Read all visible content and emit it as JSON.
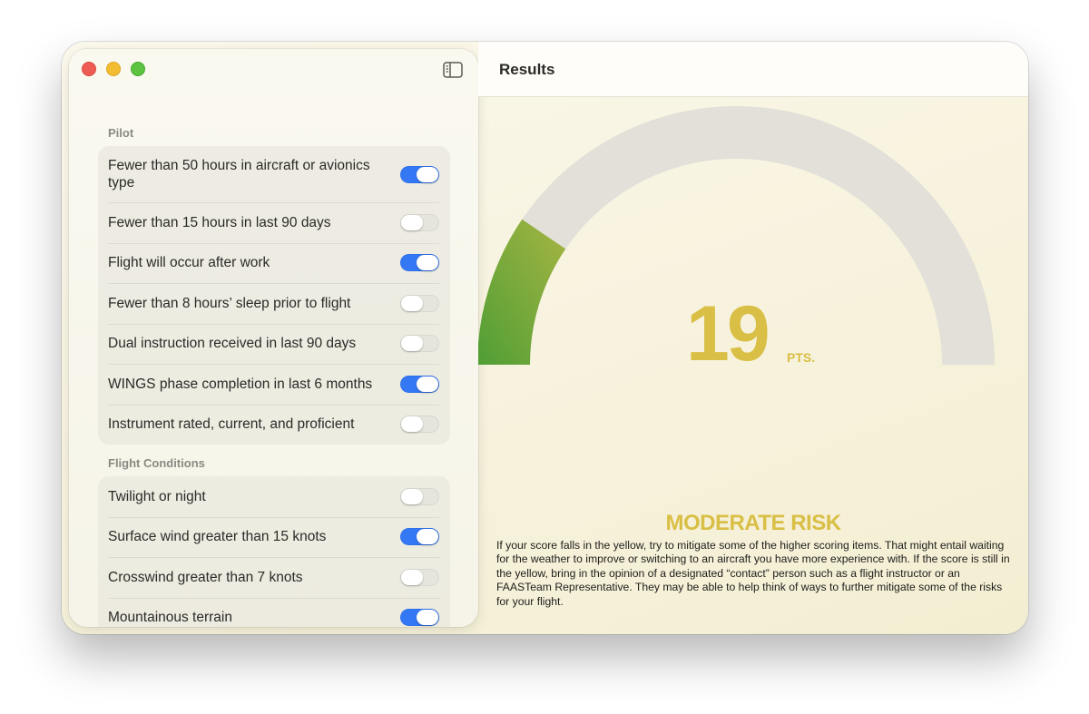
{
  "window": {
    "title": "Results"
  },
  "sidebar": {
    "sections": [
      {
        "label": "Pilot",
        "items": [
          {
            "label": "Fewer than 50 hours in aircraft or avionics type",
            "on": true
          },
          {
            "label": "Fewer than 15 hours in last 90 days",
            "on": false
          },
          {
            "label": "Flight will occur after work",
            "on": true
          },
          {
            "label": "Fewer than 8 hours’ sleep prior to flight",
            "on": false
          },
          {
            "label": "Dual instruction received in last 90 days",
            "on": false
          },
          {
            "label": "WINGS phase completion in last 6 months",
            "on": true
          },
          {
            "label": "Instrument rated, current, and proficient",
            "on": false
          }
        ]
      },
      {
        "label": "Flight Conditions",
        "items": [
          {
            "label": "Twilight or night",
            "on": false
          },
          {
            "label": "Surface wind greater than 15 knots",
            "on": true
          },
          {
            "label": "Crosswind greater than 7 knots",
            "on": false
          },
          {
            "label": "Mountainous terrain",
            "on": true
          }
        ]
      }
    ]
  },
  "results": {
    "score": "19",
    "score_unit": "PTS.",
    "gauge_fill_fraction": 0.19,
    "risk_level": "MODERATE RISK",
    "description": "If your score falls in the yellow, try to mitigate some of the higher scoring items. That might entail waiting for the weather to improve or switching to an aircraft you have more experience with. If the score is still in the yellow, bring in the opinion of a designated “contact” person such as a flight instructor or an FAASTeam Representative. They may be able to help think of ways to further mitigate some of the risks for your flight."
  },
  "colors": {
    "toggle_on": "#3478f6",
    "accent_yellow": "#d9bf45",
    "gauge_green_start": "#4f9e35",
    "gauge_green_end": "#a6b543",
    "gauge_track": "#e2e0d8"
  }
}
